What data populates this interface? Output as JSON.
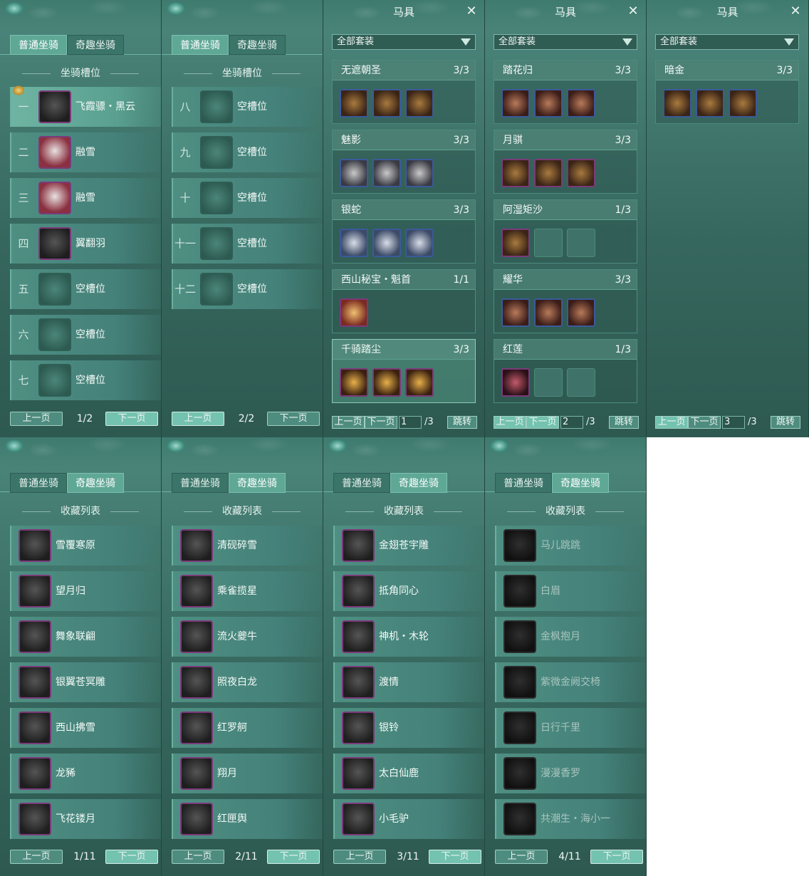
{
  "tabs": {
    "normal": "普通坐骑",
    "fun": "奇趣坐骑"
  },
  "slots_title": "坐骑槽位",
  "collection_title": "收藏列表",
  "pager": {
    "prev": "上一页",
    "next": "下一页"
  },
  "slot_pages": [
    {
      "page": "1/2",
      "rows": [
        {
          "index": "一",
          "name": "飞霞骠・黑云",
          "empty": false
        },
        {
          "index": "二",
          "name": "融雪",
          "empty": false
        },
        {
          "index": "三",
          "name": "融雪",
          "empty": false
        },
        {
          "index": "四",
          "name": "翼翻羽",
          "empty": false
        },
        {
          "index": "五",
          "name": "空槽位",
          "empty": true
        },
        {
          "index": "六",
          "name": "空槽位",
          "empty": true
        },
        {
          "index": "七",
          "name": "空槽位",
          "empty": true
        }
      ]
    },
    {
      "page": "2/2",
      "rows": [
        {
          "index": "八",
          "name": "空槽位",
          "empty": true
        },
        {
          "index": "九",
          "name": "空槽位",
          "empty": true
        },
        {
          "index": "十",
          "name": "空槽位",
          "empty": true
        },
        {
          "index": "十一",
          "name": "空槽位",
          "empty": true
        },
        {
          "index": "十二",
          "name": "空槽位",
          "empty": true
        }
      ]
    }
  ],
  "gear": {
    "title": "马具",
    "filter": "全部套装",
    "jump": "跳转",
    "pages": [
      {
        "page_input": "1",
        "total": "/3",
        "sets": [
          {
            "name": "无遮朝圣",
            "count": "3/3",
            "filled": 3
          },
          {
            "name": "魅影",
            "count": "3/3",
            "filled": 3
          },
          {
            "name": "银蛇",
            "count": "3/3",
            "filled": 3
          },
          {
            "name": "西山秘宝・魁首",
            "count": "1/1",
            "filled": 1
          },
          {
            "name": "千骑踏尘",
            "count": "3/3",
            "filled": 3
          }
        ]
      },
      {
        "page_input": "2",
        "total": "/3",
        "sets": [
          {
            "name": "踏花归",
            "count": "3/3",
            "filled": 3
          },
          {
            "name": "月骐",
            "count": "3/3",
            "filled": 3
          },
          {
            "name": "阿湿矩沙",
            "count": "1/3",
            "filled": 1
          },
          {
            "name": "耀华",
            "count": "3/3",
            "filled": 3
          },
          {
            "name": "红莲",
            "count": "1/3",
            "filled": 1
          }
        ]
      },
      {
        "page_input": "3",
        "total": "/3",
        "sets": [
          {
            "name": "暗金",
            "count": "3/3",
            "filled": 3
          }
        ]
      }
    ]
  },
  "collection_pages": [
    {
      "page": "1/11",
      "items": [
        "雪覆寒原",
        "望月归",
        "舞象联翩",
        "银翼苍冥雕",
        "西山拂雪",
        "龙豨",
        "飞花镂月"
      ],
      "dim": false
    },
    {
      "page": "2/11",
      "items": [
        "清砚碎雪",
        "乘雀揽星",
        "流火夔牛",
        "照夜白龙",
        "红罗舸",
        "翔月",
        "红匣舆"
      ],
      "dim": false
    },
    {
      "page": "3/11",
      "items": [
        "金翅苍宇雕",
        "抵角同心",
        "神机・木轮",
        "渡情",
        "银铃",
        "太白仙鹿",
        "小毛驴"
      ],
      "dim": false
    },
    {
      "page": "4/11",
      "items": [
        "马儿跳跳",
        "白眉",
        "金枫抱月",
        "紫微金阙交椅",
        "日行千里",
        "漫漫香罗",
        "共潮生・海小一"
      ],
      "dim": true
    }
  ]
}
